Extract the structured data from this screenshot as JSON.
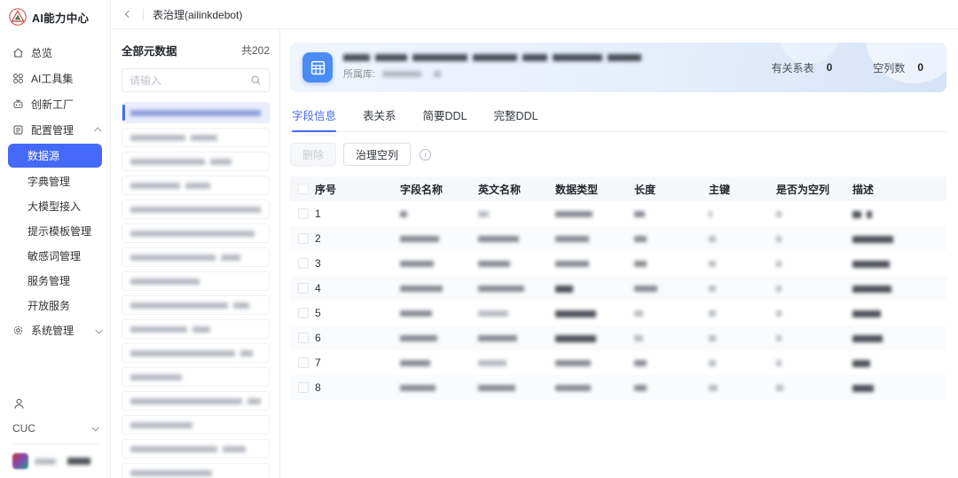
{
  "app": {
    "logo_title": "AI能力中心"
  },
  "topbar": {
    "breadcrumb": "表治理(ailinkdebot)"
  },
  "sidebar": {
    "items": [
      {
        "label": "总览",
        "icon": "home-icon"
      },
      {
        "label": "AI工具集",
        "icon": "grid-icon"
      },
      {
        "label": "创新工厂",
        "icon": "robot-icon"
      },
      {
        "label": "配置管理",
        "icon": "document-icon",
        "state": "expanded"
      },
      {
        "label": "系统管理",
        "icon": "gear-icon",
        "state": "collapsed"
      }
    ],
    "config_children": [
      "数据源",
      "字典管理",
      "大模型接入",
      "提示模板管理",
      "敏感词管理",
      "服务管理",
      "开放服务"
    ],
    "selected_child": "数据源",
    "user_org": "CUC"
  },
  "list_panel": {
    "title": "全部元数据",
    "count_label": "共202",
    "search_placeholder": "请输入",
    "visible_items": 16,
    "selected_index": 0,
    "items_redacted": true
  },
  "main": {
    "header": {
      "db_label": "所属库:",
      "title_redacted": true,
      "stats": [
        {
          "label": "有关系表",
          "value": "0"
        },
        {
          "label": "空列数",
          "value": "0"
        }
      ]
    },
    "tabs": [
      "字段信息",
      "表关系",
      "简要DDL",
      "完整DDL"
    ],
    "active_tab": "字段信息",
    "toolbar": {
      "delete_label": "删除",
      "govern_label": "治理空列"
    },
    "table": {
      "headers": [
        "序号",
        "字段名称",
        "英文名称",
        "数据类型",
        "长度",
        "主键",
        "是否为空列",
        "描述"
      ],
      "rows": [
        {
          "no": "1"
        },
        {
          "no": "2"
        },
        {
          "no": "3"
        },
        {
          "no": "4"
        },
        {
          "no": "5"
        },
        {
          "no": "6"
        },
        {
          "no": "7"
        },
        {
          "no": "8"
        }
      ],
      "cells_redacted": true
    }
  },
  "colors": {
    "accent": "#4569f8",
    "hero_icon_blue": "#4a8cf6",
    "table_header_bg": "#f6f7f9",
    "selected_item_bg": "#e9edfc"
  }
}
